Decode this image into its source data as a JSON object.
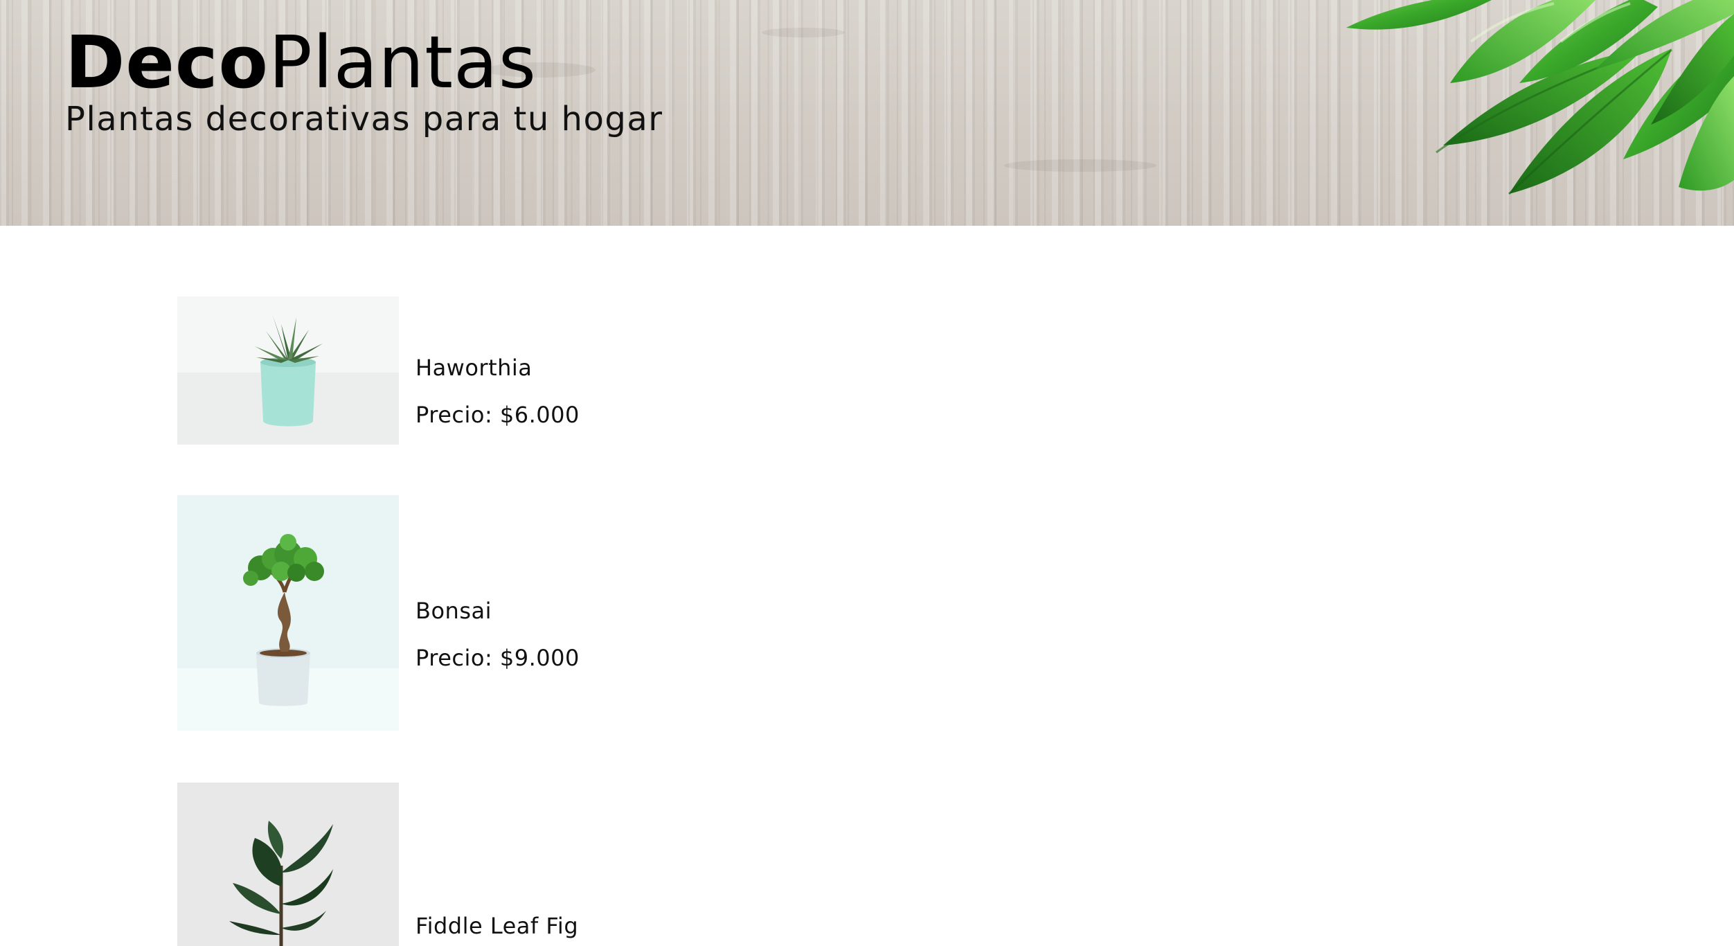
{
  "header": {
    "brand_bold": "Deco",
    "brand_light": "Plantas",
    "tagline": "Plantas decorativas para tu hogar"
  },
  "products": [
    {
      "name": "Haworthia",
      "price": "Precio: $6.000",
      "image": "haworthia-plant-photo"
    },
    {
      "name": "Bonsai",
      "price": "Precio: $9.000",
      "image": "bonsai-plant-photo"
    },
    {
      "name": "Fiddle Leaf Fig",
      "image": "fiddle-leaf-fig-plant-photo"
    }
  ],
  "colors": {
    "text": "#111111",
    "wood": "#d4cec6",
    "leaf": "#3aa82a",
    "pot_mint": "#a6e3d6",
    "pot_white": "#dfe8ea"
  }
}
